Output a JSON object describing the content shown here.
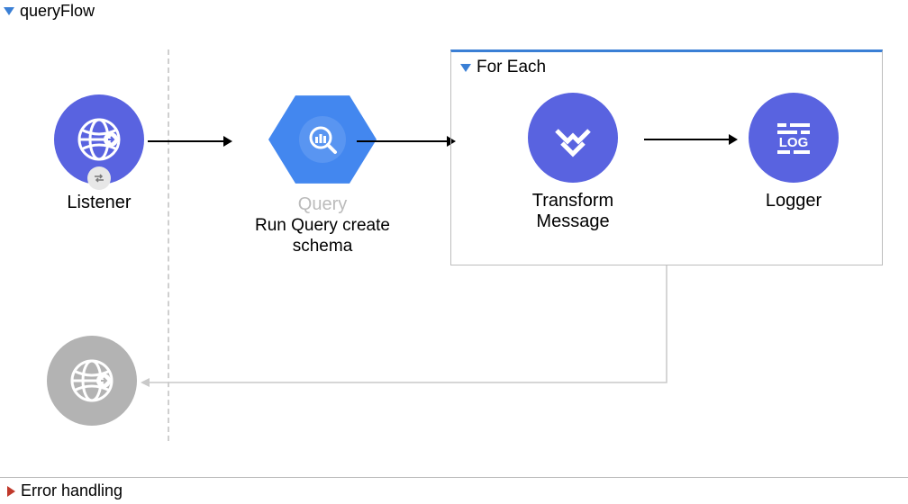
{
  "header": {
    "flow_title": "queryFlow"
  },
  "nodes": {
    "listener": {
      "label": "Listener"
    },
    "query": {
      "label_top": "Query",
      "label_line1": "Run Query create",
      "label_line2": "schema"
    },
    "transform": {
      "label_line1": "Transform",
      "label_line2": "Message"
    },
    "logger": {
      "label": "Logger"
    }
  },
  "foreach": {
    "title": "For Each"
  },
  "footer": {
    "error_handling": "Error handling"
  }
}
